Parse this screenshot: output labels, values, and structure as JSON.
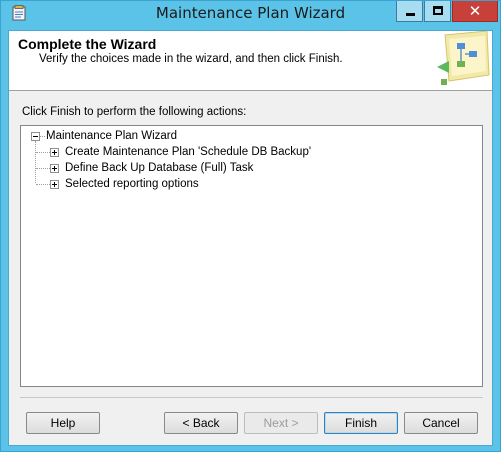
{
  "window": {
    "title": "Maintenance Plan Wizard"
  },
  "header": {
    "title": "Complete the Wizard",
    "subtitle": "Verify the choices made in the wizard, and then click Finish."
  },
  "instructions": "Click Finish to perform the following actions:",
  "tree": {
    "root": {
      "label": "Maintenance Plan Wizard",
      "expanded": true
    },
    "children": [
      {
        "label": "Create Maintenance Plan 'Schedule DB Backup'",
        "expanded": false
      },
      {
        "label": "Define Back Up Database (Full) Task",
        "expanded": false
      },
      {
        "label": "Selected reporting options",
        "expanded": false
      }
    ]
  },
  "buttons": {
    "help": "Help",
    "back": "< Back",
    "next": "Next >",
    "finish": "Finish",
    "cancel": "Cancel"
  },
  "icons": {
    "app": "maintenance-plan-app-icon",
    "minimize": "minimize-icon",
    "maximize": "maximize-icon",
    "close": "close-icon",
    "wizard": "wizard-flowchart-graphic"
  },
  "colors": {
    "frame": "#5bc3e8",
    "close": "#c7413a"
  }
}
